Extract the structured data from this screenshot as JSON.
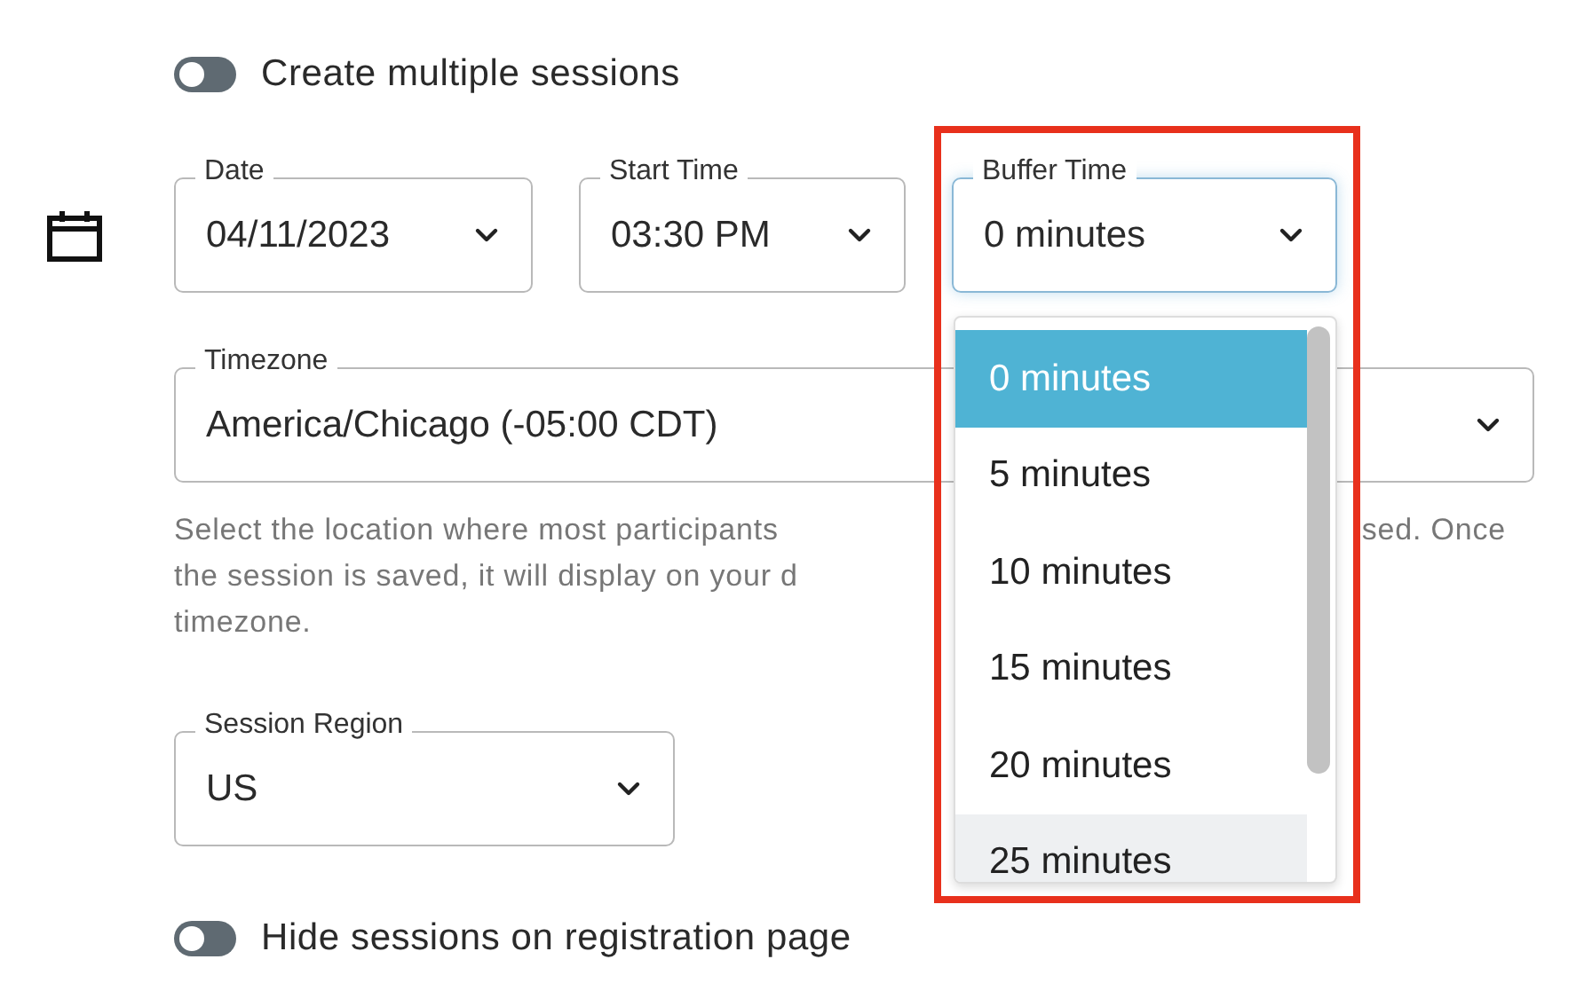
{
  "multiple_sessions_toggle": {
    "label": "Create multiple sessions",
    "on": false
  },
  "datetime_fields": [
    {
      "label": "Date",
      "value": "04/11/2023",
      "focused": false
    },
    {
      "label": "Start Time",
      "value": "03:30 PM",
      "focused": false
    },
    {
      "label": "Buffer Time",
      "value": "0 minutes",
      "focused": true
    }
  ],
  "timezone": {
    "label": "Timezone",
    "value": "America/Chicago (-05:00 CDT)"
  },
  "timezone_help": [
    {
      "left": "Select the location where most participants",
      "right": "sed. Once"
    },
    {
      "left": "the session is saved, it will display on your d"
    },
    {
      "left": "timezone."
    }
  ],
  "session_region": {
    "label": "Session Region",
    "value": "US"
  },
  "hide_sessions_toggle": {
    "label": "Hide sessions on registration page",
    "on": false
  },
  "buffer_dropdown": {
    "options": [
      {
        "label": "0 minutes",
        "selected": true,
        "hovered": false
      },
      {
        "label": "5 minutes",
        "selected": false,
        "hovered": false
      },
      {
        "label": "10 minutes",
        "selected": false,
        "hovered": false
      },
      {
        "label": "15 minutes",
        "selected": false,
        "hovered": false
      },
      {
        "label": "20 minutes",
        "selected": false,
        "hovered": false
      },
      {
        "label": "25 minutes",
        "selected": false,
        "hovered": true
      }
    ]
  },
  "highlight": {
    "color": "#e8301c"
  }
}
